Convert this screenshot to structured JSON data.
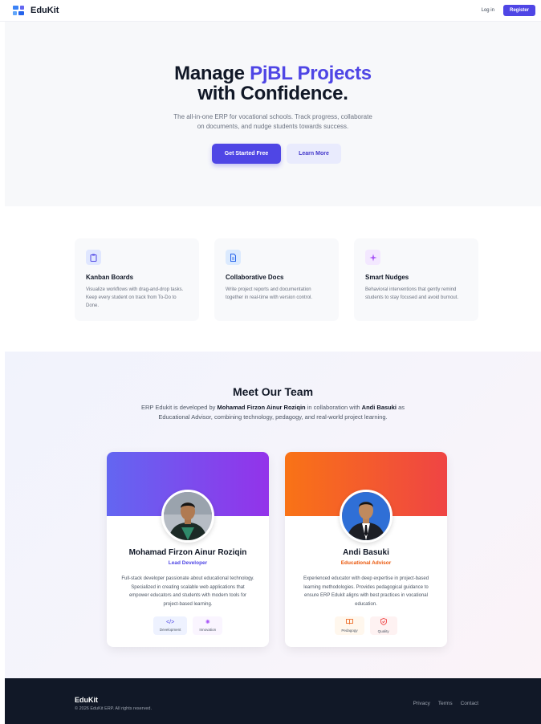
{
  "header": {
    "brand": "EduKit",
    "login_label": "Log in",
    "register_label": "Register"
  },
  "hero": {
    "title_part1": "Manage ",
    "title_accent": "PjBL Projects",
    "title_line2": "with Confidence.",
    "subtitle_line1": "The all-in-one ERP for vocational schools. Track progress, collaborate",
    "subtitle_line2": "on documents, and nudge students towards success.",
    "primary_cta": "Get Started Free",
    "secondary_cta": "Learn More"
  },
  "features": [
    {
      "icon": "clipboard-icon",
      "title": "Kanban Boards",
      "description": "Visualize workflows with drag-and-drop tasks. Keep every student on track from To-Do to Done."
    },
    {
      "icon": "document-icon",
      "title": "Collaborative Docs",
      "description": "Write project reports and documentation together in real-time with version control."
    },
    {
      "icon": "sparkle-icon",
      "title": "Smart Nudges",
      "description": "Behavioral interventions that gently remind students to stay focused and avoid burnout."
    }
  ],
  "team": {
    "title": "Meet Our Team",
    "intro_part1": "ERP Edukit is developed by ",
    "intro_name1": "Mohamad Firzon Ainur Roziqin",
    "intro_part2": " in collaboration with ",
    "intro_name2": "Andi Basuki",
    "intro_part3": " as Educational Advisor, combining technology, pedagogy, and real-world project learning.",
    "members": [
      {
        "name": "Mohamad Firzon Ainur Roziqin",
        "role": "Lead Developer",
        "bio": "Full-stack developer passionate about educational technology. Specialized in creating scalable web applications that empower educators and students with modern tools for project-based learning.",
        "tags": [
          {
            "icon": "code-icon",
            "label": "Development"
          },
          {
            "icon": "lightbulb-icon",
            "label": "Innovation"
          }
        ]
      },
      {
        "name": "Andi Basuki",
        "role": "Educational Advisor",
        "bio": "Experienced educator with deep expertise in project-based learning methodologies. Provides pedagogical guidance to ensure ERP Edukit aligns with best practices in vocational education.",
        "tags": [
          {
            "icon": "book-icon",
            "label": "Pedagogy"
          },
          {
            "icon": "shield-check-icon",
            "label": "Quality"
          }
        ]
      }
    ]
  },
  "footer": {
    "brand": "EduKit",
    "copyright": "© 2026 EduKit ERP. All rights reserved.",
    "links": [
      "Privacy",
      "Terms",
      "Contact"
    ]
  },
  "colors": {
    "accent": "#4f46e5",
    "developer_banner": "#7c3aed",
    "advisor_banner": "#f97316",
    "footer_bg": "#111827"
  }
}
